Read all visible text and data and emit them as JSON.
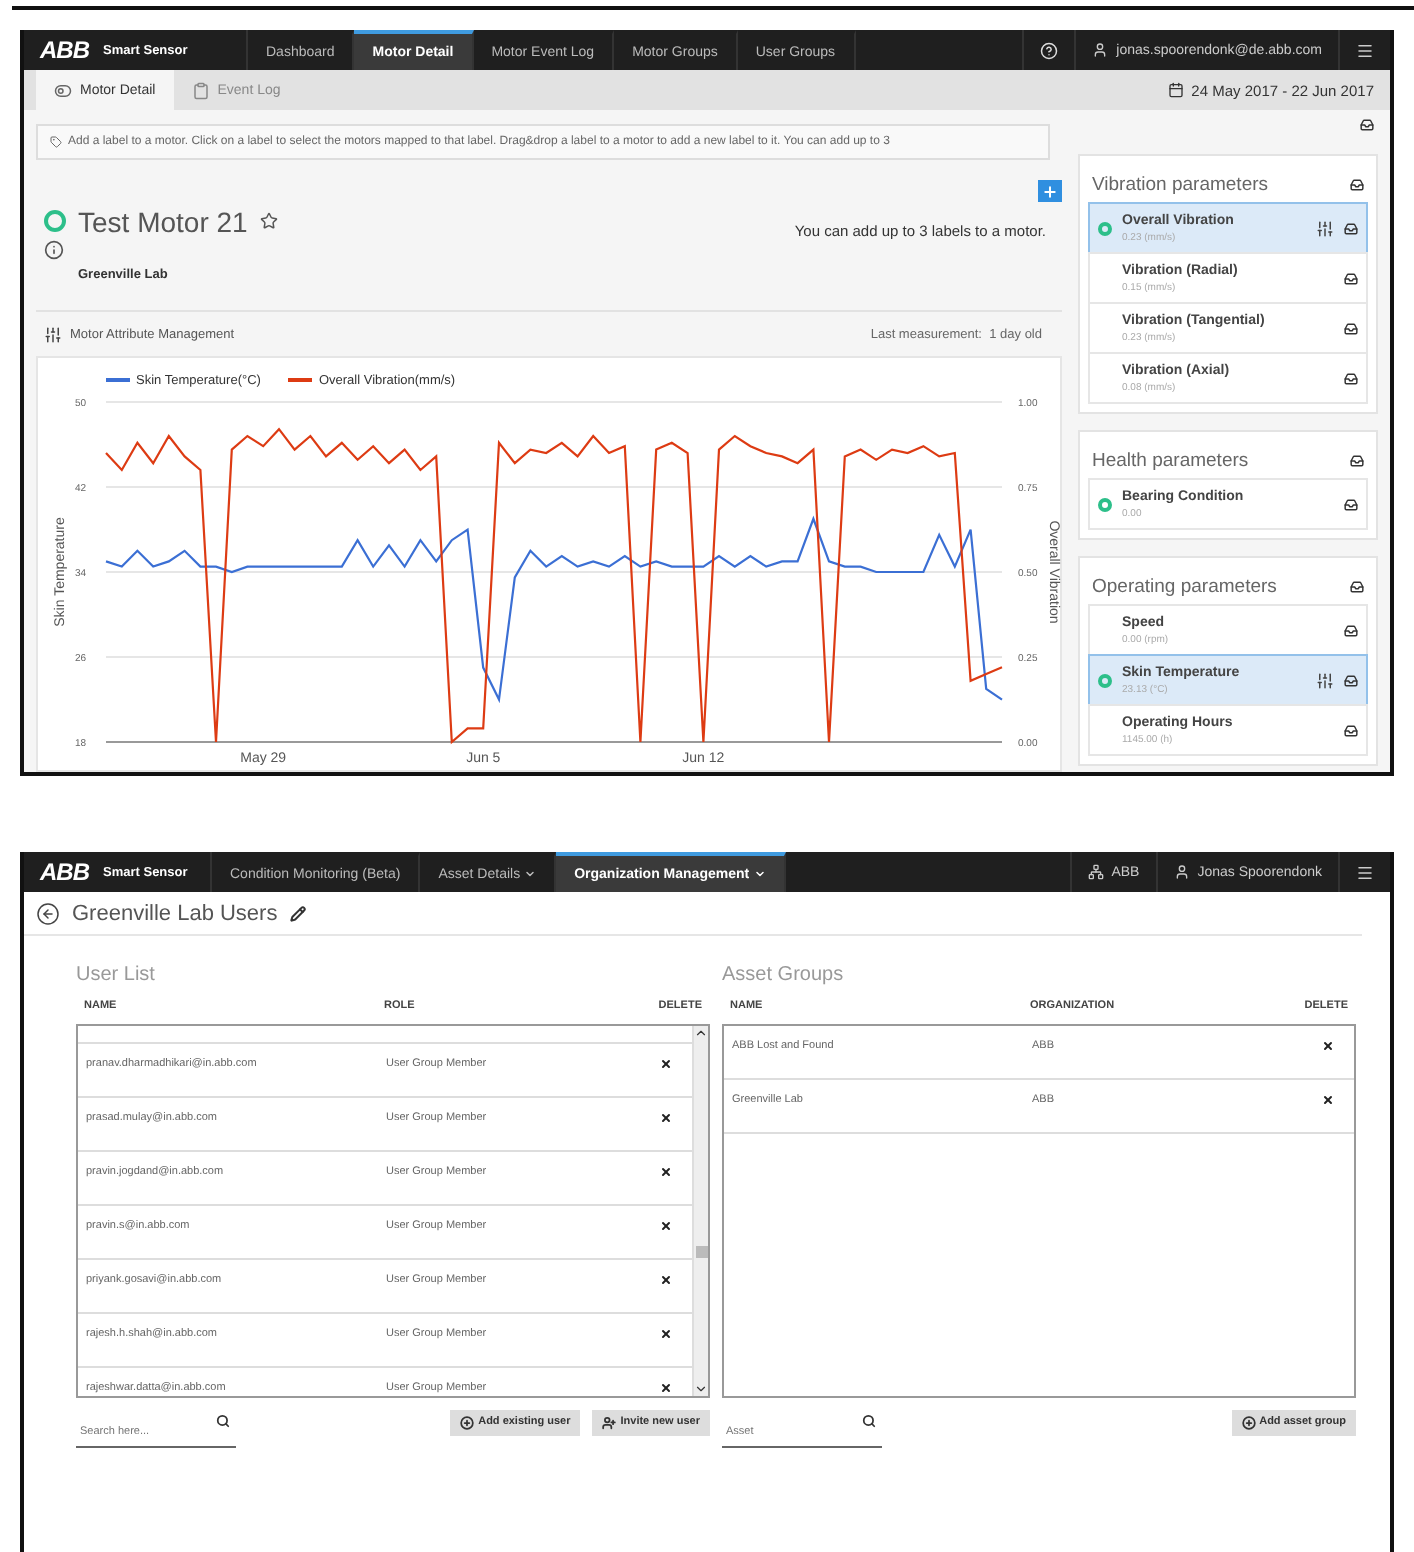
{
  "top_app": {
    "navbar": {
      "logo": "ABB",
      "product": "Smart Sensor",
      "user": "jonas.spoorendonk@de.abb.com",
      "tabs": [
        {
          "label": "Dashboard",
          "selected": false
        },
        {
          "label": "Motor Detail",
          "selected": true
        },
        {
          "label": "Motor Event Log",
          "selected": false
        },
        {
          "label": "Motor Groups",
          "selected": false
        },
        {
          "label": "User Groups",
          "selected": false
        }
      ]
    },
    "subtabs": [
      {
        "label": "Motor Detail",
        "selected": true,
        "kind": "toggle"
      },
      {
        "label": "Event Log",
        "selected": false,
        "kind": "clipboard"
      }
    ],
    "date_range": "24 May 2017 - 22 Jun 2017",
    "label_hint": "Add a label to a motor. Click on a label to select the motors mapped to that label. Drag&drop a label to a motor to add a new label to it. You can add up to 3",
    "motor": {
      "name": "Test Motor 21",
      "starred": false,
      "label_note": "You can add up to 3 labels to a motor.",
      "location": "Greenville Lab"
    },
    "attribute_section": {
      "title": "Motor Attribute Management",
      "last_measurement_label": "Last measurement:",
      "last_measurement_value": "1 day old"
    },
    "chart_data": {
      "type": "line",
      "grid": true,
      "legend": "top",
      "ylabel": "Skin Temperature",
      "y2label": "Overall Vibration",
      "ylim": [
        18,
        50
      ],
      "y2lim": [
        0,
        1
      ],
      "yticks": [
        18,
        26,
        34,
        42,
        50
      ],
      "y2ticks": [
        {
          "value": 0,
          "label": "0.00"
        },
        {
          "value": 0.25,
          "label": "0.25"
        },
        {
          "value": 0.5,
          "label": "0.50"
        },
        {
          "value": 0.75,
          "label": "0.75"
        },
        {
          "value": 1,
          "label": "1.00"
        }
      ],
      "categories": [
        null,
        null,
        null,
        null,
        null,
        null,
        null,
        null,
        null,
        null,
        "May 29",
        null,
        null,
        null,
        null,
        null,
        null,
        null,
        null,
        null,
        null,
        null,
        null,
        null,
        "Jun 5",
        null,
        null,
        null,
        null,
        null,
        null,
        null,
        null,
        null,
        null,
        null,
        null,
        null,
        "Jun 12",
        null,
        null,
        null,
        null,
        null,
        null,
        null,
        null,
        null,
        null,
        null,
        null,
        null,
        null,
        null,
        null,
        null,
        null,
        null
      ],
      "series": [
        {
          "name": "Skin Temperature(°C)",
          "color": "#3b6fd4",
          "values": [
            35,
            34.5,
            36,
            34.5,
            35,
            36,
            34.5,
            34.5,
            34,
            34.5,
            34.5,
            34.5,
            34.5,
            34.5,
            34.5,
            34.5,
            37,
            34.5,
            36.5,
            34.5,
            37,
            35,
            37,
            38,
            25,
            22,
            33.5,
            36,
            34.5,
            35.5,
            34.5,
            35,
            34.5,
            35.5,
            34.5,
            35,
            34.5,
            34.5,
            34.5,
            35.5,
            34.5,
            35.5,
            34.5,
            35,
            35,
            39,
            35,
            34.5,
            34.5,
            34,
            34,
            34,
            34,
            37.5,
            34.5,
            38,
            23,
            22
          ]
        },
        {
          "name": "Overall Vibration(mm/s)",
          "color": "#dd3b13",
          "axis": "y2",
          "values": [
            0.85,
            0.8,
            0.88,
            0.82,
            0.9,
            0.84,
            0.8,
            0,
            0.86,
            0.9,
            0.87,
            0.92,
            0.86,
            0.9,
            0.84,
            0.88,
            0.83,
            0.87,
            0.82,
            0.86,
            0.8,
            0.84,
            0,
            0.04,
            0.04,
            0.88,
            0.82,
            0.86,
            0.85,
            0.88,
            0.84,
            0.9,
            0.85,
            0.87,
            0,
            0.86,
            0.88,
            0.85,
            0,
            0.86,
            0.9,
            0.87,
            0.85,
            0.84,
            0.82,
            0.86,
            0,
            0.84,
            0.86,
            0.83,
            0.86,
            0.85,
            0.87,
            0.84,
            0.85,
            0.18,
            0.2,
            0.22
          ]
        }
      ]
    },
    "parameter_groups": [
      {
        "title": "Vibration parameters",
        "items": [
          {
            "name": "Overall Vibration",
            "value": "0.23 (mm/s)",
            "selected": true,
            "status_dot": true
          },
          {
            "name": "Vibration (Radial)",
            "value": "0.15 (mm/s)",
            "selected": false,
            "status_dot": false
          },
          {
            "name": "Vibration (Tangential)",
            "value": "0.23 (mm/s)",
            "selected": false,
            "status_dot": false
          },
          {
            "name": "Vibration (Axial)",
            "value": "0.08 (mm/s)",
            "selected": false,
            "status_dot": false
          }
        ]
      },
      {
        "title": "Health parameters",
        "items": [
          {
            "name": "Bearing Condition",
            "value": "0.00",
            "selected": false,
            "status_dot": true
          }
        ]
      },
      {
        "title": "Operating parameters",
        "items": [
          {
            "name": "Speed",
            "value": "0.00 (rpm)",
            "selected": false,
            "status_dot": false
          },
          {
            "name": "Skin Temperature",
            "value": "23.13 (°C)",
            "selected": true,
            "status_dot": true
          },
          {
            "name": "Operating Hours",
            "value": "1145.00 (h)",
            "selected": false,
            "status_dot": false
          }
        ]
      }
    ]
  },
  "bottom_app": {
    "navbar": {
      "logo": "ABB",
      "product": "Smart Sensor",
      "organization": "ABB",
      "user": "Jonas Spoorendonk",
      "tabs": [
        {
          "label": "Condition Monitoring (Beta)",
          "selected": false,
          "dropdown": false
        },
        {
          "label": "Asset Details",
          "selected": false,
          "dropdown": true
        },
        {
          "label": "Organization Management",
          "selected": true,
          "dropdown": true
        }
      ]
    },
    "page_title": "Greenville Lab Users",
    "user_list": {
      "title": "User List",
      "columns": [
        "NAME",
        "ROLE",
        "DELETE"
      ],
      "search_placeholder": "Search here...",
      "rows": [
        {
          "name": "pranav.dharmadhikari@in.abb.com",
          "role": "User Group Member"
        },
        {
          "name": "prasad.mulay@in.abb.com",
          "role": "User Group Member"
        },
        {
          "name": "pravin.jogdand@in.abb.com",
          "role": "User Group Member"
        },
        {
          "name": "pravin.s@in.abb.com",
          "role": "User Group Member"
        },
        {
          "name": "priyank.gosavi@in.abb.com",
          "role": "User Group Member"
        },
        {
          "name": "rajesh.h.shah@in.abb.com",
          "role": "User Group Member"
        },
        {
          "name": "rajeshwar.datta@in.abb.com",
          "role": "User Group Member"
        }
      ],
      "buttons": [
        {
          "label": "Add existing user",
          "kind": "add"
        },
        {
          "label": "Invite new user",
          "kind": "invite"
        }
      ]
    },
    "asset_groups": {
      "title": "Asset Groups",
      "columns": [
        "NAME",
        "ORGANIZATION",
        "DELETE"
      ],
      "search_placeholder": "Asset",
      "rows": [
        {
          "name": "ABB Lost and Found",
          "organization": "ABB"
        },
        {
          "name": "Greenville Lab",
          "organization": "ABB"
        }
      ],
      "buttons": [
        {
          "label": "Add asset group",
          "kind": "add"
        }
      ]
    }
  }
}
